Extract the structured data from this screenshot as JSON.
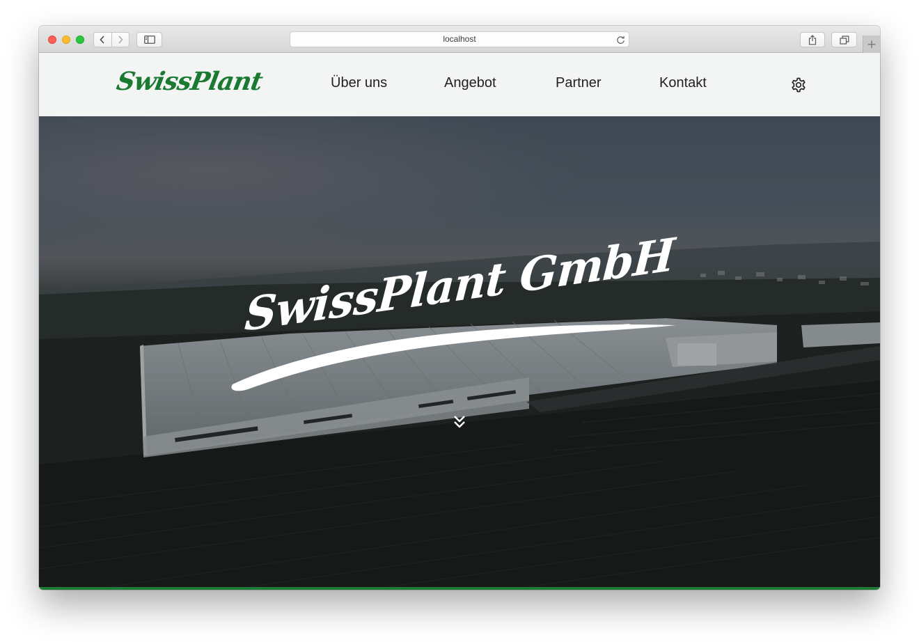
{
  "browser": {
    "url": "localhost",
    "icons": [
      "back-icon",
      "forward-icon",
      "sidebar-icon",
      "reload-icon",
      "share-icon",
      "tabs-icon",
      "plus-icon"
    ],
    "new_tab_symbol": "+"
  },
  "header": {
    "logo": "SwissPlant",
    "nav": [
      {
        "label": "Über uns"
      },
      {
        "label": "Angebot"
      },
      {
        "label": "Partner"
      },
      {
        "label": "Kontakt"
      }
    ],
    "settings_icon": "gear-icon"
  },
  "hero": {
    "title": "SwissPlant GmbH",
    "scroll_icon": "double-chevron-down-icon"
  },
  "colors": {
    "brand_green": "#1d7a37",
    "header_bg": "#f3f4f4",
    "nav_text": "#1f1f1f"
  }
}
